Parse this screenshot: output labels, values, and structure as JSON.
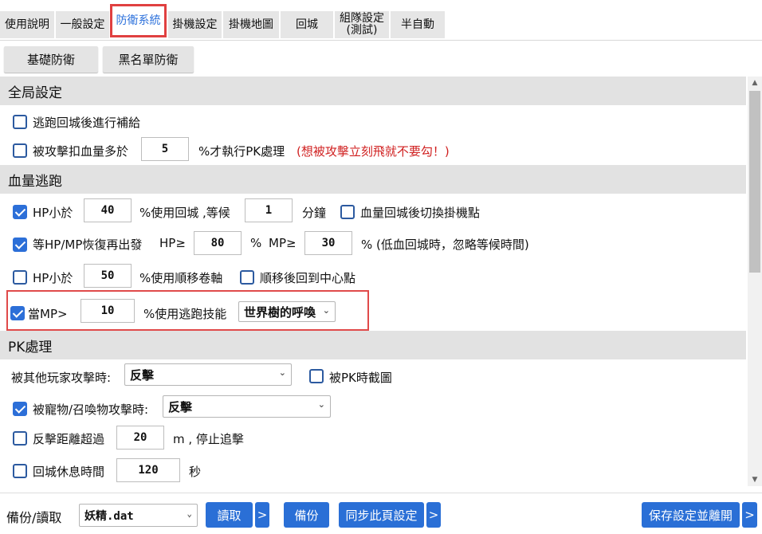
{
  "tabs": [
    "使用說明",
    "一般設定",
    "防衛系統",
    "掛機設定",
    "掛機地圖",
    "回城",
    "組隊設定\n(測試)",
    "半自動"
  ],
  "active_tab": "防衛系統",
  "subtabs": [
    "基礎防衛",
    "黑名單防衛"
  ],
  "global": {
    "header": "全局設定",
    "opt1": "逃跑回城後進行補給",
    "opt2_label": "被攻擊扣血量多於",
    "opt2_value": "5",
    "opt2_suffix": "%才執行PK處理",
    "opt2_note": "(想被攻擊立刻飛就不要勾！)"
  },
  "escape": {
    "header": "血量逃跑",
    "hp_label": "HP小於",
    "hp_value": "40",
    "hp_mid": "%使用回城 ,等候",
    "wait_value": "1",
    "wait_unit": "分鐘",
    "switch_label": "血量回城後切換掛機點",
    "recover_label": "等HP/MP恢復再出發",
    "hp_ge": "HP≥",
    "hp_ge_value": "80",
    "pct": "%",
    "mp_ge": "MP≥",
    "mp_ge_value": "30",
    "recover_note": "% (低血回城時，忽略等候時間)",
    "scroll_label": "HP小於",
    "scroll_value": "50",
    "scroll_suffix": "%使用順移卷軸",
    "center_label": "順移後回到中心點",
    "mp_label": "當MP>",
    "mp_value": "10",
    "mp_suffix": "%使用逃跑技能",
    "skill_selected": "世界樹的呼喚"
  },
  "pk": {
    "header": "PK處理",
    "attacked_label": "被其他玩家攻擊時:",
    "attacked_value": "反擊",
    "screenshot_label": "被PK時截圖",
    "pet_label": "被寵物/召喚物攻擊時:",
    "pet_value": "反擊",
    "distance_label": "反擊距離超過",
    "distance_value": "20",
    "distance_suffix": "m , 停止追擊",
    "rest_label": "回城休息時間",
    "rest_value": "120",
    "rest_unit": "秒"
  },
  "bottom": {
    "backup_label": "備份/讀取",
    "file_value": "妖精.dat",
    "read_btn": "讀取",
    "more": ">",
    "backup_btn": "備份",
    "sync_btn": "同步此頁設定",
    "save_btn": "保存設定並離開"
  },
  "colors": {
    "accent": "#2a6fd6",
    "highlight": "#e04040",
    "warning": "#d02020"
  }
}
